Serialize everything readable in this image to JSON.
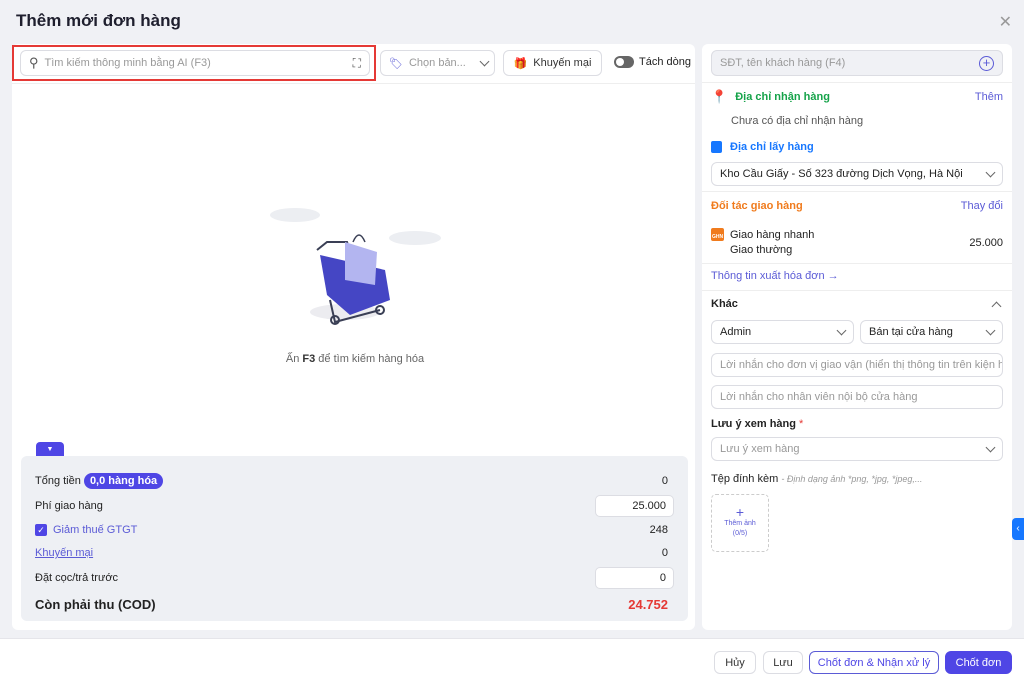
{
  "title": "Thêm mới đơn hàng",
  "toolbar": {
    "search_placeholder": "Tìm kiếm thông minh bằng AI (F3)",
    "price_placeholder": "Chọn bản...",
    "promo_label": "Khuyến mại",
    "split_label": "Tách dòng"
  },
  "empty": {
    "prefix": "Ấn ",
    "key": "F3",
    "suffix": " để tìm kiếm hàng hóa"
  },
  "summary": {
    "total_label": "Tổng tiền",
    "items_badge": "0,0 hàng hóa",
    "total_value": "0",
    "shipping_label": "Phí giao hàng",
    "shipping_value": "25.000",
    "vat_label": "Giảm thuế GTGT",
    "vat_value": "248",
    "vat_checked": true,
    "promo_label": "Khuyến mại",
    "promo_value": "0",
    "deposit_label": "Đặt cọc/trả trước",
    "deposit_value": "0",
    "cod_label": "Còn phải thu (COD)",
    "cod_value": "24.752"
  },
  "customer": {
    "placeholder": "SĐT, tên khách hàng (F4)"
  },
  "delivery": {
    "title": "Địa chỉ nhận hàng",
    "add": "Thêm",
    "empty": "Chưa có địa chỉ nhận hàng"
  },
  "pickup": {
    "title": "Địa chỉ lấy hàng",
    "value": "Kho Cầu Giấy - Số 323 đường Dịch Vọng, Hà Nội"
  },
  "carrier": {
    "title": "Đối tác giao hàng",
    "change": "Thay đổi",
    "logo": "GHN",
    "name": "Giao hàng nhanh",
    "service": "Giao thường",
    "fee": "25.000"
  },
  "invoice_link": "Thông tin xuất hóa đơn →",
  "other": {
    "title": "Khác",
    "staff": "Admin",
    "channel": "Bán tại cửa hàng",
    "carrier_note_placeholder": "Lời nhắn cho đơn vị giao vận (hiển thị thông tin trên kiện hà",
    "internal_note_placeholder": "Lời nhắn cho nhân viên nội bộ cửa hàng",
    "inspect_label": "Lưu ý xem hàng",
    "required": "*",
    "inspect_placeholder": "Lưu ý xem hàng",
    "attach_label": "Tệp đính kèm",
    "attach_hint": "- Định dạng ảnh *png, *jpg, *jpeg,...",
    "add_image": "Thêm ảnh",
    "image_count": "(0/5)"
  },
  "footer": {
    "cancel": "Hủy",
    "save": "Lưu",
    "confirm_process": "Chốt đơn & Nhận xử lý",
    "confirm": "Chốt đơn"
  },
  "colors": {
    "accent": "#4f46e5",
    "green": "#16a34a",
    "blue": "#1677ff",
    "orange": "#f07b1d",
    "red": "#e53935"
  }
}
